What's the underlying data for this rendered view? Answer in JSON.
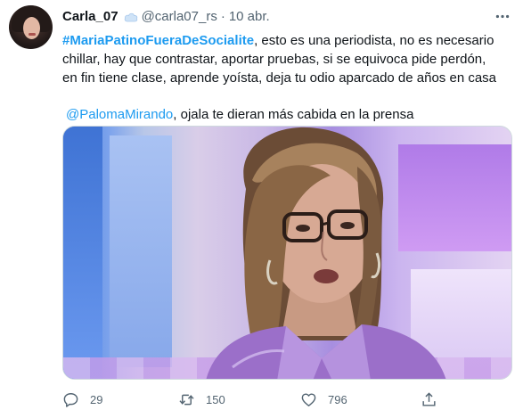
{
  "tweet": {
    "author_name": "Carla_07",
    "handle": "@carla07_rs",
    "separator": "·",
    "date": "10 abr.",
    "hashtag": "#MariaPatinoFueraDeSocialite",
    "line1_rest": ", esto es una periodista, no es necesario",
    "line2": "chillar,  hay que contrastar, aportar pruebas, si se equivoca pide perdón,",
    "line3": "en fin tiene clase, aprende yoísta, deja tu odio aparcado de años en casa",
    "mention": "@PalomaMirando",
    "mention_rest": ", ojala te dieran más cabida en la prensa"
  },
  "actions": {
    "replies": "29",
    "retweets": "150",
    "likes": "796"
  },
  "colors": {
    "link": "#1d9bf0",
    "muted": "#536471",
    "text": "#0f1419"
  }
}
